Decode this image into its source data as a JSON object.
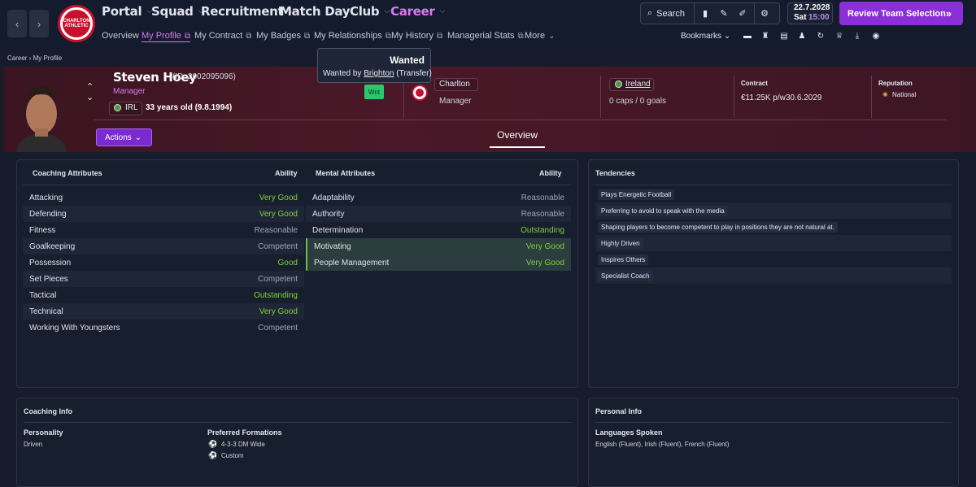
{
  "nav": {
    "back_icon": "chevron-left-icon",
    "forward_icon": "chevron-right-icon",
    "club_crest_text": "CHARLTON ATHLETIC",
    "menus": [
      "Portal",
      "Squad",
      "Recruitment",
      "Match Day",
      "Club",
      "Career"
    ],
    "active_menu": "Career",
    "submenu": [
      {
        "label": "Overview",
        "external": false
      },
      {
        "label": "My Profile",
        "external": true
      },
      {
        "label": "My Contract",
        "external": true
      },
      {
        "label": "My Badges",
        "external": true
      },
      {
        "label": "My Relationships",
        "external": true
      },
      {
        "label": "My History",
        "external": true
      },
      {
        "label": "Managerial Stats",
        "external": true
      },
      {
        "label": "More",
        "external": false
      }
    ],
    "active_submenu": "My Profile",
    "search_label": "Search",
    "date": "22.7.2028",
    "day": "Sat",
    "time": "15:00",
    "review_label": "Review Team Selection",
    "bookmarks_label": "Bookmarks"
  },
  "breadcrumb": {
    "parent": "Career",
    "current": "My Profile"
  },
  "tooltip": {
    "title": "Wanted",
    "text_prefix": "Wanted by",
    "club_link": "Brighton",
    "text_suffix": "(Transfer)"
  },
  "profile": {
    "name": "Steven Hoey",
    "id_text": "(ID: 2002095096)",
    "role": "Manager",
    "nationality_code": "IRL",
    "age_text": "33 years old (9.8.1994)",
    "wanted_badge": "Wnt",
    "club": "Charlton",
    "club_role": "Manager",
    "nation": "Ireland",
    "caps_text": "0 caps / 0 goals",
    "contract_label": "Contract",
    "contract_wage": "€11.25K p/w",
    "contract_end": "30.6.2029",
    "reputation_label": "Reputation",
    "reputation_value": "National",
    "actions_label": "Actions",
    "tab": "Overview"
  },
  "coaching": {
    "header": "Coaching Attributes",
    "ability_label": "Ability",
    "rows": [
      {
        "name": "Attacking",
        "value": "Very Good",
        "tone": "green"
      },
      {
        "name": "Defending",
        "value": "Very Good",
        "tone": "green"
      },
      {
        "name": "Fitness",
        "value": "Reasonable",
        "tone": "grey"
      },
      {
        "name": "Goalkeeping",
        "value": "Competent",
        "tone": "grey"
      },
      {
        "name": "Possession",
        "value": "Good",
        "tone": "green"
      },
      {
        "name": "Set Pieces",
        "value": "Competent",
        "tone": "grey"
      },
      {
        "name": "Tactical",
        "value": "Outstanding",
        "tone": "green"
      },
      {
        "name": "Technical",
        "value": "Very Good",
        "tone": "green"
      },
      {
        "name": "Working With Youngsters",
        "value": "Competent",
        "tone": "grey"
      }
    ]
  },
  "mental": {
    "header": "Mental Attributes",
    "ability_label": "Ability",
    "rows": [
      {
        "name": "Adaptability",
        "value": "Reasonable",
        "tone": "grey"
      },
      {
        "name": "Authority",
        "value": "Reasonable",
        "tone": "grey"
      },
      {
        "name": "Determination",
        "value": "Outstanding",
        "tone": "green"
      },
      {
        "name": "Motivating",
        "value": "Very Good",
        "tone": "green"
      },
      {
        "name": "People Management",
        "value": "Very Good",
        "tone": "green"
      }
    ]
  },
  "tendencies": {
    "header": "Tendencies",
    "items": [
      "Plays Energetic Football",
      "Preferring to avoid to speak with the media",
      "Shaping players to become competent to play in positions they are not natural at.",
      "Highly Driven",
      "Inspires Others",
      "Specialist Coach"
    ]
  },
  "coaching_info": {
    "header": "Coaching Info",
    "personality_label": "Personality",
    "personality_value": "Driven",
    "formations_label": "Preferred Formations",
    "formations": [
      "4-3-3 DM Wide",
      "Custom"
    ]
  },
  "personal_info": {
    "header": "Personal Info",
    "languages_label": "Languages Spoken",
    "languages_value": "English (Fluent), Irish (Fluent), French (Fluent)"
  },
  "colors": {
    "accent": "#8b2fd6",
    "career": "#d77cf2",
    "green": "#7dd23a",
    "header_bg": "#4a1828"
  }
}
